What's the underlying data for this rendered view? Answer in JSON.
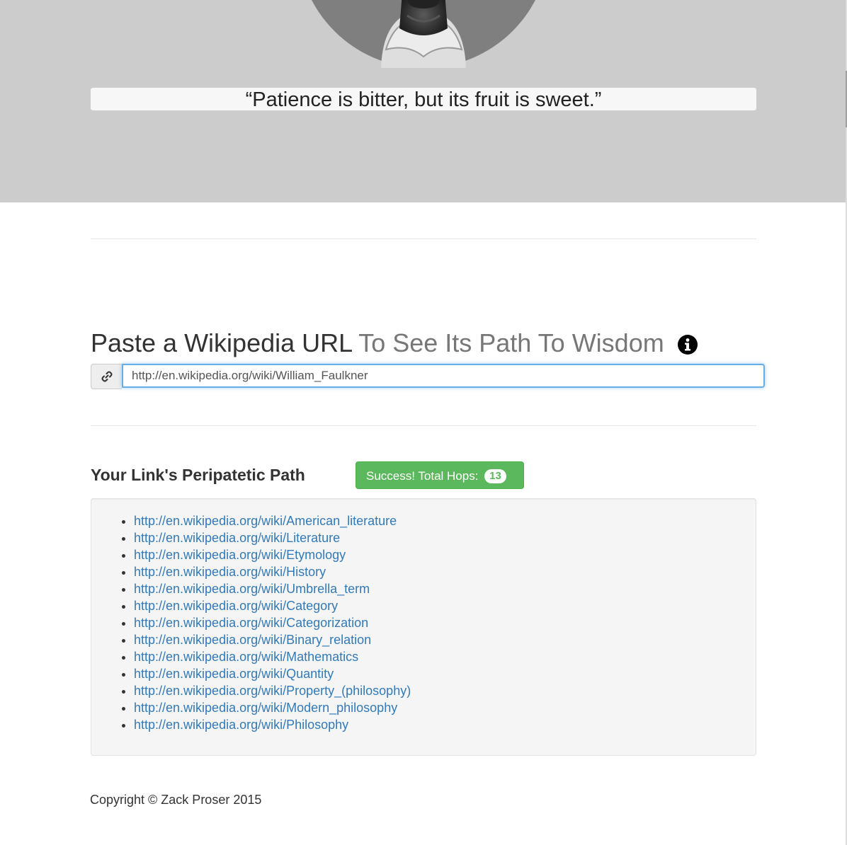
{
  "hero": {
    "quote": "“Patience is bitter, but its fruit is sweet.”",
    "background_color": "#cccccc",
    "portrait_icon": "portrait-image"
  },
  "search": {
    "heading_main": "Paste a Wikipedia URL",
    "heading_muted": "To See Its Path To Wisdom",
    "info_icon": "info-circle-icon",
    "link_icon": "link-icon",
    "input_value": "http://en.wikipedia.org/wiki/William_Faulkner"
  },
  "results": {
    "heading": "Your Link's Peripatetic Path",
    "success_label": "Success! Total Hops:",
    "hops": "13",
    "success_color": "#5cb85c",
    "link_color": "#337ab7",
    "links": [
      "http://en.wikipedia.org/wiki/American_literature",
      "http://en.wikipedia.org/wiki/Literature",
      "http://en.wikipedia.org/wiki/Etymology",
      "http://en.wikipedia.org/wiki/History",
      "http://en.wikipedia.org/wiki/Umbrella_term",
      "http://en.wikipedia.org/wiki/Category",
      "http://en.wikipedia.org/wiki/Categorization",
      "http://en.wikipedia.org/wiki/Binary_relation",
      "http://en.wikipedia.org/wiki/Mathematics",
      "http://en.wikipedia.org/wiki/Quantity",
      "http://en.wikipedia.org/wiki/Property_(philosophy)",
      "http://en.wikipedia.org/wiki/Modern_philosophy",
      "http://en.wikipedia.org/wiki/Philosophy"
    ]
  },
  "footer": {
    "copyright": "Copyright © Zack Proser 2015"
  }
}
